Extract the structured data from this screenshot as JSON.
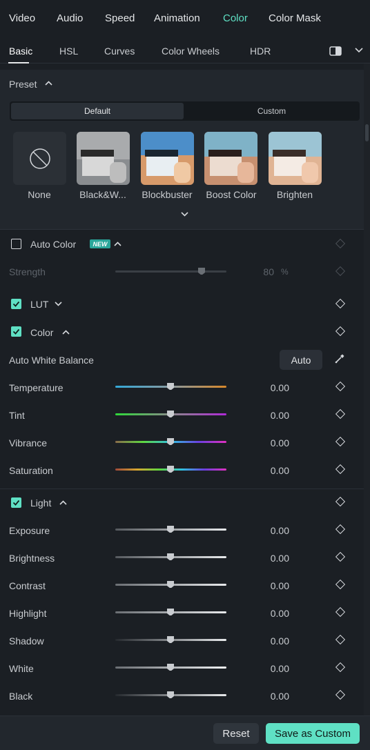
{
  "top_tabs": [
    {
      "label": "Video"
    },
    {
      "label": "Audio"
    },
    {
      "label": "Speed"
    },
    {
      "label": "Animation"
    },
    {
      "label": "Color",
      "active": true
    },
    {
      "label": "Color Mask"
    }
  ],
  "sub_tabs": [
    {
      "label": "Basic",
      "active": true
    },
    {
      "label": "HSL"
    },
    {
      "label": "Curves"
    },
    {
      "label": "Color Wheels"
    },
    {
      "label": "HDR"
    }
  ],
  "preset": {
    "title": "Preset",
    "segments": [
      "Default",
      "Custom"
    ],
    "selected_segment": "Default",
    "items": [
      {
        "label": "None"
      },
      {
        "label": "Black&W..."
      },
      {
        "label": "Blockbuster"
      },
      {
        "label": "Boost Color"
      },
      {
        "label": "Brighten"
      }
    ]
  },
  "auto_color": {
    "label": "Auto Color",
    "badge": "NEW",
    "checked": false,
    "strength": {
      "label": "Strength",
      "value": "80",
      "unit": "%",
      "level": 0.8
    }
  },
  "lut": {
    "label": "LUT",
    "checked": true
  },
  "color": {
    "label": "Color",
    "checked": true,
    "awb_label": "Auto White Balance",
    "auto_button": "Auto",
    "sliders": [
      {
        "label": "Temperature",
        "value": "0.00",
        "level": 0.5
      },
      {
        "label": "Tint",
        "value": "0.00",
        "level": 0.5
      },
      {
        "label": "Vibrance",
        "value": "0.00",
        "level": 0.5
      },
      {
        "label": "Saturation",
        "value": "0.00",
        "level": 0.5
      }
    ]
  },
  "light": {
    "label": "Light",
    "checked": true,
    "sliders": [
      {
        "label": "Exposure",
        "value": "0.00",
        "level": 0.5
      },
      {
        "label": "Brightness",
        "value": "0.00",
        "level": 0.5
      },
      {
        "label": "Contrast",
        "value": "0.00",
        "level": 0.5
      },
      {
        "label": "Highlight",
        "value": "0.00",
        "level": 0.5
      },
      {
        "label": "Shadow",
        "value": "0.00",
        "level": 0.5
      },
      {
        "label": "White",
        "value": "0.00",
        "level": 0.5
      },
      {
        "label": "Black",
        "value": "0.00",
        "level": 0.5
      }
    ]
  },
  "footer": {
    "reset": "Reset",
    "save": "Save as Custom"
  },
  "colors": {
    "accent": "#5fe0c4",
    "panel": "#22272d",
    "background": "#1b1f24"
  }
}
